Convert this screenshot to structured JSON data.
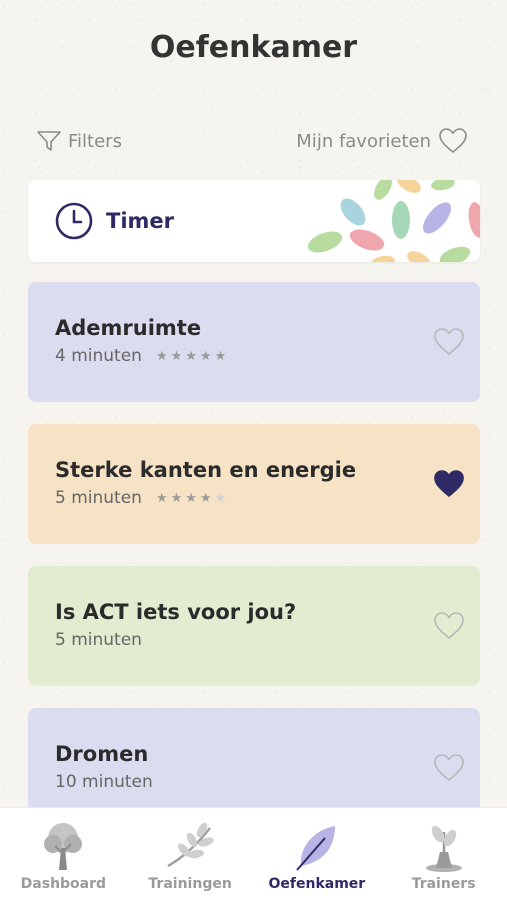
{
  "page": {
    "title": "Oefenkamer"
  },
  "toolbar": {
    "filters_label": "Filters",
    "favorites_label": "Mijn favorieten"
  },
  "timer": {
    "label": "Timer"
  },
  "exercises": [
    {
      "title": "Ademruimte",
      "duration": "4 minuten",
      "rating": 5,
      "favorite": false,
      "color": "#dcdcf0"
    },
    {
      "title": "Sterke kanten en energie",
      "duration": "5 minuten",
      "rating": 4,
      "favorite": true,
      "color": "#f6e2c4"
    },
    {
      "title": "Is ACT iets voor jou?",
      "duration": "5 minuten",
      "rating": 0,
      "favorite": false,
      "color": "#e1ecd0"
    },
    {
      "title": "Dromen",
      "duration": "10 minuten",
      "rating": 0,
      "favorite": false,
      "color": "#dcdcf0"
    }
  ],
  "nav": {
    "items": [
      {
        "label": "Dashboard",
        "icon": "tree-icon",
        "active": false
      },
      {
        "label": "Trainingen",
        "icon": "branch-icon",
        "active": false
      },
      {
        "label": "Oefenkamer",
        "icon": "leaf-icon",
        "active": true
      },
      {
        "label": "Trainers",
        "icon": "sprout-icon",
        "active": false
      }
    ]
  },
  "colors": {
    "accent": "#2e2a66",
    "background": "#f6f4ef"
  }
}
